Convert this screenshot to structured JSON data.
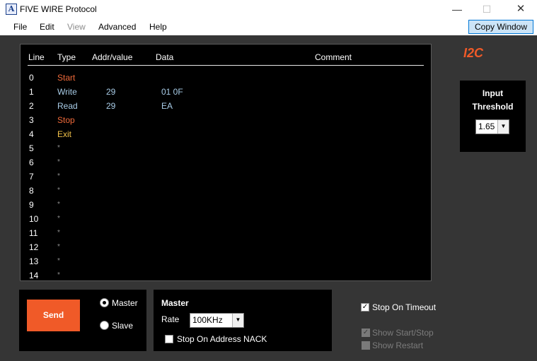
{
  "window": {
    "icon_letter": "A",
    "title": "FIVE WIRE Protocol",
    "minimize": "—",
    "maximize": "☐",
    "close": "✕"
  },
  "menu": {
    "file": "File",
    "edit": "Edit",
    "view": "View",
    "advanced": "Advanced",
    "help": "Help",
    "copy_window": "Copy Window"
  },
  "grid": {
    "headers": {
      "line": "Line",
      "type": "Type",
      "addr": "Addr/value",
      "data": "Data",
      "comment": "Comment"
    },
    "rows": [
      {
        "line": "0",
        "type": "Start",
        "addr": "",
        "data": ""
      },
      {
        "line": "1",
        "type": "Write",
        "addr": "29",
        "data": "01   0F"
      },
      {
        "line": "2",
        "type": "Read",
        "addr": "29",
        "data": "EA"
      },
      {
        "line": "3",
        "type": "Stop",
        "addr": "",
        "data": ""
      },
      {
        "line": "4",
        "type": "Exit",
        "addr": "",
        "data": ""
      },
      {
        "line": "5",
        "type": "*",
        "addr": "",
        "data": ""
      },
      {
        "line": "6",
        "type": "*",
        "addr": "",
        "data": ""
      },
      {
        "line": "7",
        "type": "*",
        "addr": "",
        "data": ""
      },
      {
        "line": "8",
        "type": "*",
        "addr": "",
        "data": ""
      },
      {
        "line": "9",
        "type": "*",
        "addr": "",
        "data": ""
      },
      {
        "line": "10",
        "type": "*",
        "addr": "",
        "data": ""
      },
      {
        "line": "11",
        "type": "*",
        "addr": "",
        "data": ""
      },
      {
        "line": "12",
        "type": "*",
        "addr": "",
        "data": ""
      },
      {
        "line": "13",
        "type": "*",
        "addr": "",
        "data": ""
      },
      {
        "line": "14",
        "type": "*",
        "addr": "",
        "data": ""
      }
    ]
  },
  "protocol_label": "I2C",
  "threshold": {
    "label_line1": "Input",
    "label_line2": "Threshold",
    "value": "1.65"
  },
  "send": {
    "button": "Send",
    "master_label": "Master",
    "slave_label": "Slave",
    "selected": "Master"
  },
  "master": {
    "title": "Master",
    "rate_label": "Rate",
    "rate_value": "100KHz",
    "stop_on_nack_label": "Stop On Address NACK",
    "stop_on_nack_checked": false
  },
  "options": {
    "stop_on_timeout_label": "Stop On Timeout",
    "stop_on_timeout_checked": true,
    "show_start_stop_label": "Show Start/Stop",
    "show_start_stop_checked": true,
    "show_restart_label": "Show Restart",
    "show_restart_checked": false
  },
  "colors": {
    "accent": "#f05a28",
    "background": "#353535",
    "panel": "#000000"
  }
}
